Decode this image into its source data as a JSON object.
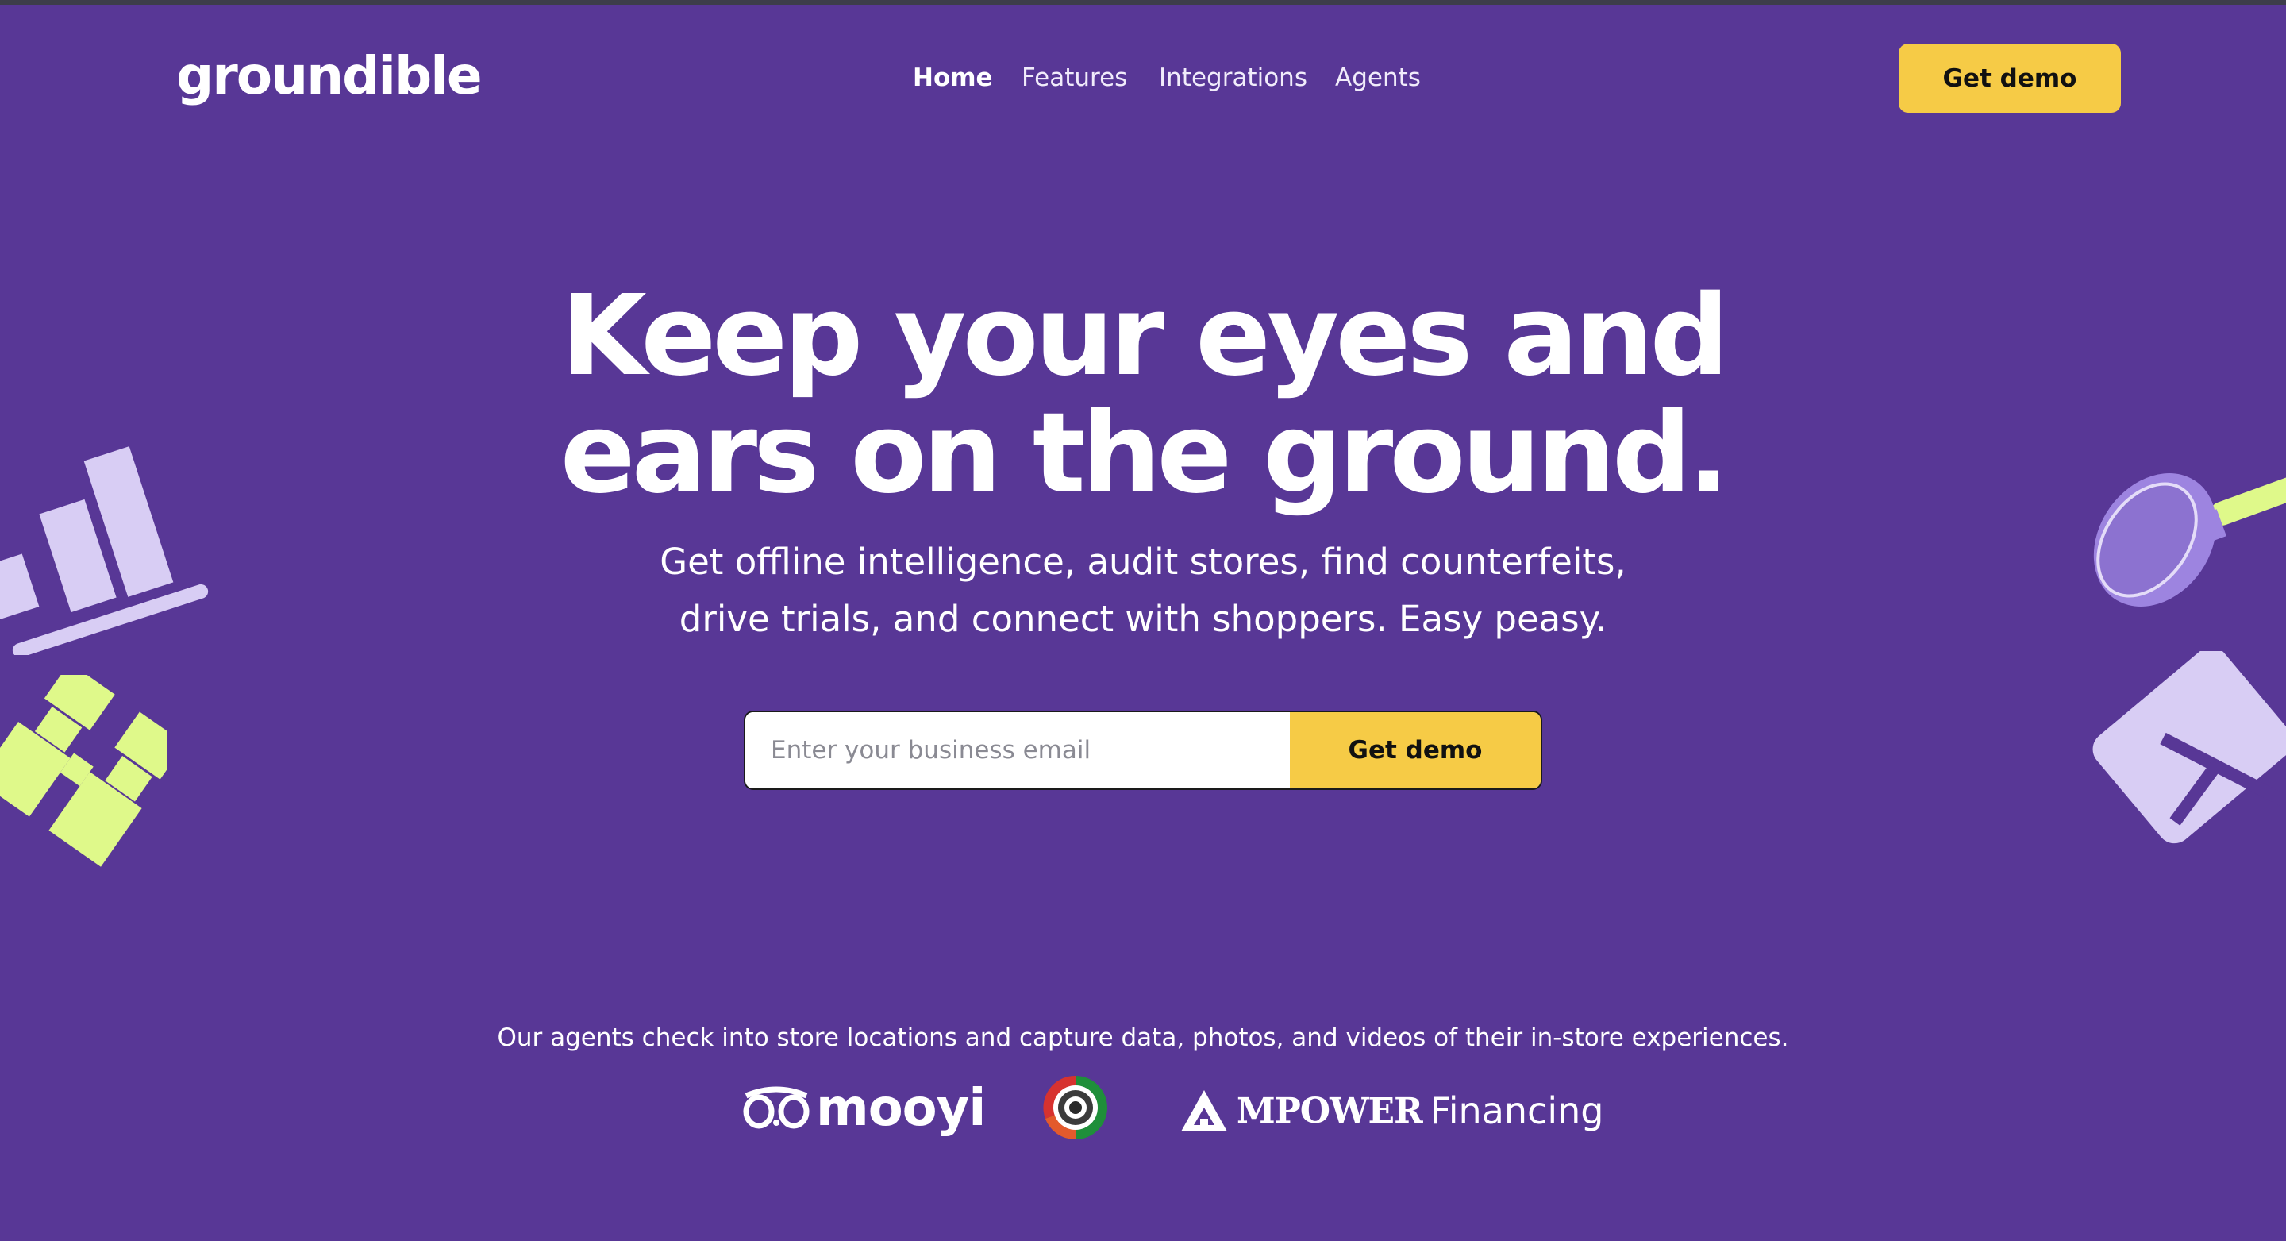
{
  "brand": {
    "logo_text": "groundible"
  },
  "nav": {
    "items": [
      {
        "label": "Home",
        "active": true
      },
      {
        "label": "Features",
        "active": false
      },
      {
        "label": "Integrations",
        "active": false
      },
      {
        "label": "Agents",
        "active": false
      }
    ],
    "cta_label": "Get demo"
  },
  "hero": {
    "headline_line1": "Keep your eyes and",
    "headline_line2": "ears on the ground.",
    "sub_line1": "Get offline intelligence, audit stores, find counterfeits,",
    "sub_line2": "drive trials, and connect with shoppers. Easy peasy.",
    "email_placeholder": "Enter your business email",
    "email_value": "",
    "cta_label": "Get demo"
  },
  "partners": {
    "caption": "Our agents check into store locations and capture data, photos, and videos of their in-store experiences.",
    "mooyi_mark": "o,o",
    "mooyi_text": "mooyi",
    "mpower_bold": "MPOWER",
    "mpower_light": "Financing"
  },
  "colors": {
    "background": "#583796",
    "accent_yellow": "#f6cb46",
    "lavender": "#d8cdf4",
    "lime": "#dff98a"
  },
  "icons": [
    "bar-chart-icon",
    "binoculars-icon",
    "magnifier-icon",
    "map-fold-icon",
    "mpower-triangle-icon",
    "round-badge-icon"
  ]
}
